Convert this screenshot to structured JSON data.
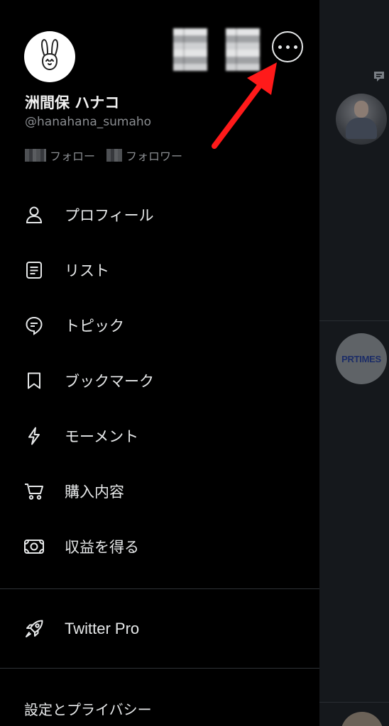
{
  "profile": {
    "display_name": "洲間保 ハナコ",
    "handle": "@hanahana_sumaho",
    "following_label": "フォロー",
    "followers_label": "フォロワー"
  },
  "header": {
    "more_icon": "more-horizontal-icon"
  },
  "menu": {
    "items": [
      {
        "label": "プロフィール",
        "icon": "person-icon"
      },
      {
        "label": "リスト",
        "icon": "list-icon"
      },
      {
        "label": "トピック",
        "icon": "topic-icon"
      },
      {
        "label": "ブックマーク",
        "icon": "bookmark-icon"
      },
      {
        "label": "モーメント",
        "icon": "lightning-icon"
      },
      {
        "label": "購入内容",
        "icon": "cart-icon"
      },
      {
        "label": "収益を得る",
        "icon": "money-icon"
      }
    ],
    "twitter_pro": {
      "label": "Twitter Pro",
      "icon": "rocket-icon"
    },
    "settings_label": "設定とプライバシー"
  },
  "feed": {
    "pr_avatar_text": "PRTIMES"
  },
  "colors": {
    "background": "#000000",
    "text": "#e7e9ea",
    "muted": "#8a8d91",
    "annotation_arrow": "#ff1a1a"
  }
}
